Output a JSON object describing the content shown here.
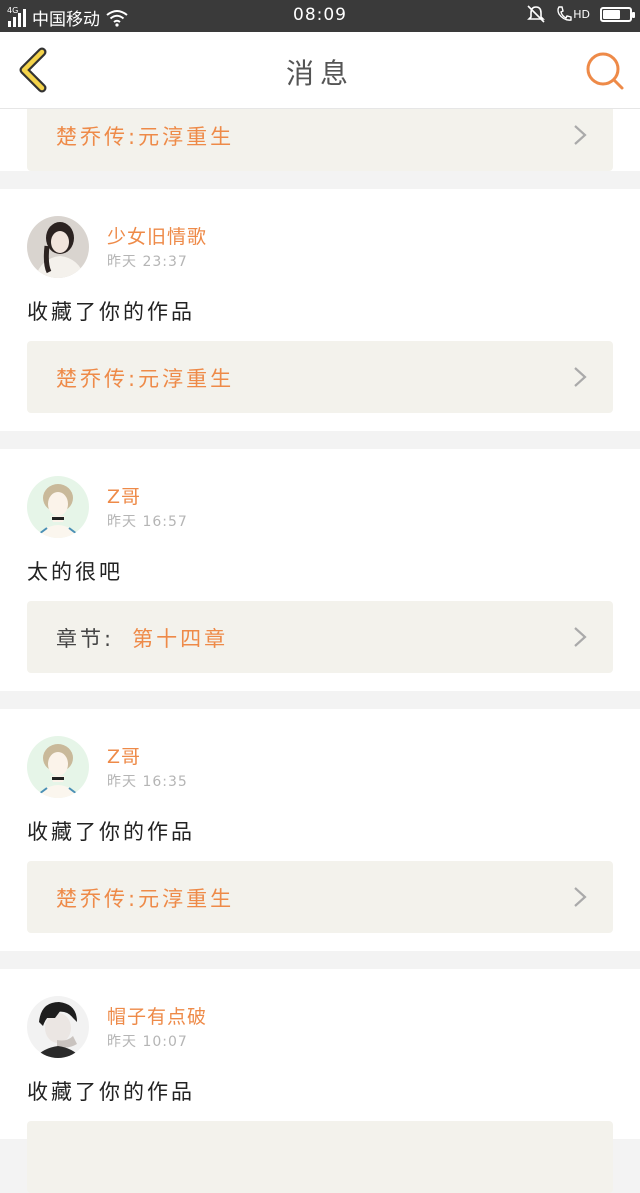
{
  "status_bar": {
    "network": "4G",
    "carrier": "中国移动",
    "time": "08:09",
    "hd": "HD",
    "battery_level": 0.6
  },
  "header": {
    "title": "消息",
    "accent": "#ee8a48"
  },
  "first_card": {
    "work_title": "楚乔传:元淳重生"
  },
  "messages": [
    {
      "username": "少女旧情歌",
      "time": "昨天 23:37",
      "text": "收藏了你的作品",
      "work_prefix": "",
      "work_title": "楚乔传:元淳重生"
    },
    {
      "username": "Z哥",
      "time": "昨天 16:57",
      "text": "太的很吧",
      "work_prefix": "章节:",
      "work_title": "第十四章"
    },
    {
      "username": "Z哥",
      "time": "昨天 16:35",
      "text": "收藏了你的作品",
      "work_prefix": "",
      "work_title": "楚乔传:元淳重生"
    },
    {
      "username": "帽子有点破",
      "time": "昨天 10:07",
      "text": "收藏了你的作品",
      "work_prefix": "",
      "work_title": ""
    }
  ]
}
